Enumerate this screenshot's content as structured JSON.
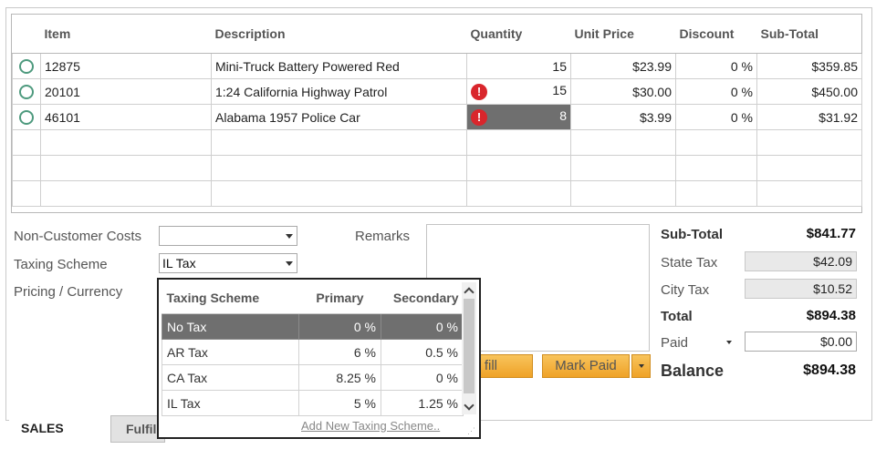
{
  "grid": {
    "columns": [
      "",
      "Item",
      "Description",
      "Quantity",
      "Unit Price",
      "Discount",
      "Sub-Total"
    ],
    "rows": [
      {
        "item": "12875",
        "description": "Mini-Truck Battery Powered Red",
        "quantity": "15",
        "unit_price": "$23.99",
        "discount": "0 %",
        "subtotal": "$359.85",
        "error": false,
        "highlight": false
      },
      {
        "item": "20101",
        "description": "1:24 California Highway Patrol",
        "quantity": "15",
        "unit_price": "$30.00",
        "discount": "0 %",
        "subtotal": "$450.00",
        "error": true,
        "highlight": false
      },
      {
        "item": "46101",
        "description": "Alabama 1957 Police Car",
        "quantity": "8",
        "unit_price": "$3.99",
        "discount": "0 %",
        "subtotal": "$31.92",
        "error": true,
        "highlight": true
      }
    ],
    "error_glyph": "!"
  },
  "form": {
    "non_customer_costs_label": "Non-Customer Costs",
    "non_customer_costs_value": "",
    "taxing_scheme_label": "Taxing Scheme",
    "taxing_scheme_value": "IL Tax",
    "pricing_currency_label": "Pricing / Currency",
    "remarks_label": "Remarks"
  },
  "buttons": {
    "fulfill_label": "fill",
    "mark_paid_label": "Mark Paid"
  },
  "totals": {
    "subtotal_label": "Sub-Total",
    "subtotal_value": "$841.77",
    "state_tax_label": "State Tax",
    "state_tax_value": "$42.09",
    "city_tax_label": "City Tax",
    "city_tax_value": "$10.52",
    "total_label": "Total",
    "total_value": "$894.38",
    "paid_label": "Paid",
    "paid_value": "$0.00",
    "balance_label": "Balance",
    "balance_value": "$894.38"
  },
  "tabs": [
    {
      "label": "SALES",
      "active": true
    },
    {
      "label": "Fulfill",
      "active": false
    }
  ],
  "dropdown": {
    "columns": [
      "Taxing Scheme",
      "Primary",
      "Secondary"
    ],
    "rows": [
      {
        "name": "No Tax",
        "primary": "0 %",
        "secondary": "0 %",
        "selected": true
      },
      {
        "name": "AR Tax",
        "primary": "6 %",
        "secondary": "0.5 %",
        "selected": false
      },
      {
        "name": "CA Tax",
        "primary": "8.25 %",
        "secondary": "0 %",
        "selected": false
      },
      {
        "name": "IL Tax",
        "primary": "5 %",
        "secondary": "1.25 %",
        "selected": false
      }
    ],
    "add_link": "Add New Taxing Scheme.."
  },
  "colors": {
    "button_orange": "#f0a830",
    "selection_gray": "#6f6f6f",
    "error_red": "#d9262c",
    "radio_green": "#4e9a7e"
  }
}
